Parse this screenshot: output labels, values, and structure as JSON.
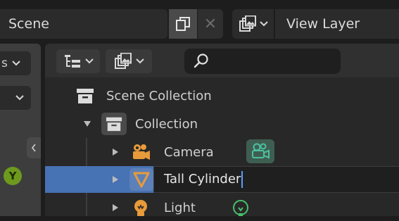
{
  "header": {
    "scene_name": "Scene",
    "view_layer_name": "View Layer"
  },
  "left_panel": {
    "dropdown_1_label": "s",
    "gizmo_axis": "Y"
  },
  "outliner": {
    "search": {
      "value": "",
      "placeholder": ""
    },
    "rows": [
      {
        "label": "Scene Collection",
        "icon": "scene-collection-icon"
      },
      {
        "label": "Collection",
        "icon": "collection-icon",
        "expanded": true
      },
      {
        "label": "Camera",
        "icon": "camera-object-icon",
        "data_icon": "camera-data-icon"
      },
      {
        "label": "Tall Cylinder",
        "icon": "cone-mesh-icon",
        "selected": true,
        "renaming": true
      },
      {
        "label": "Light",
        "icon": "light-object-icon",
        "data_icon": "light-data-icon"
      }
    ]
  },
  "colors": {
    "selection": "#4772b3",
    "object_orange": "#e89b3a",
    "data_teal": "#4cc1a0",
    "data_green": "#48c06a",
    "gizmo_y": "#6d9a1e"
  }
}
